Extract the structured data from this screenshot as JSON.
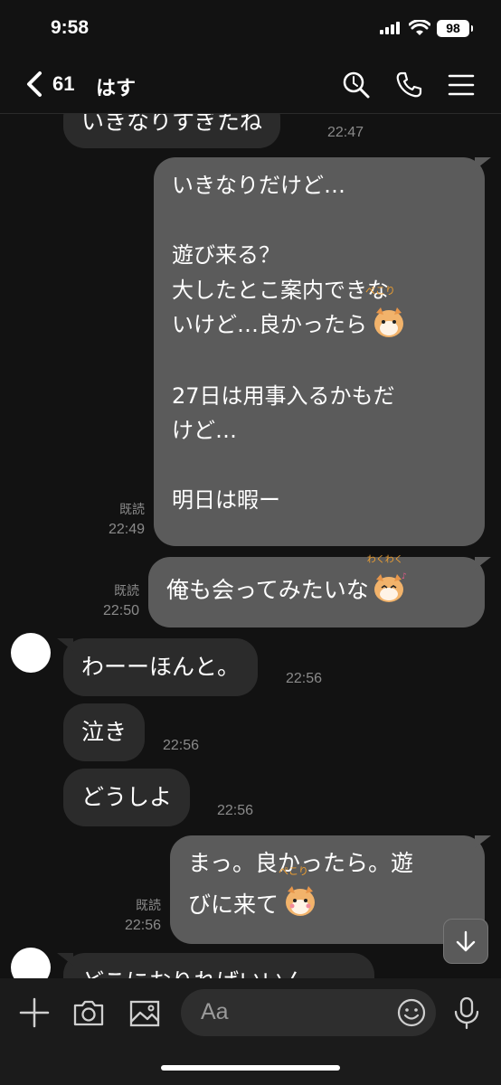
{
  "status": {
    "time": "9:58",
    "battery": "98"
  },
  "header": {
    "unread_count": "61",
    "chat_name": "はす"
  },
  "messages": {
    "m0": {
      "text": "いきなりすぎたね",
      "time": "22:47"
    },
    "m1": {
      "lines": [
        "いきなりだけど…",
        "",
        "遊び来る？",
        "大したとこ案内できな",
        "いけど…良かったら",
        "",
        "27日は用事入るかもだ",
        "けど…",
        "",
        "明日は暇ー"
      ],
      "read": "既読",
      "time": "22:49",
      "sticker_caption": "ぺこり"
    },
    "m2": {
      "text": "俺も会ってみたいな",
      "read": "既読",
      "time": "22:50",
      "sticker_caption": "わくわく"
    },
    "m3": {
      "text": "わーーほんと。",
      "time": "22:56"
    },
    "m4": {
      "text": "泣き",
      "time": "22:56"
    },
    "m5": {
      "text": "どうしよ",
      "time": "22:56"
    },
    "m6": {
      "lines": [
        "まっ。良かったら。遊",
        "びに来て"
      ],
      "read": "既読",
      "time": "22:56",
      "sticker_caption": "ぺこり"
    },
    "m7": {
      "text": "どこにおりればいいん"
    }
  },
  "input": {
    "placeholder": "Aa"
  },
  "icons": [
    "back-chevron-icon",
    "search-icon",
    "phone-icon",
    "menu-icon",
    "plus-icon",
    "camera-icon",
    "image-icon",
    "emoji-icon",
    "microphone-icon",
    "arrow-down-icon"
  ],
  "colors": {
    "background": "#121212",
    "received_bubble": "#2b2b2b",
    "sent_bubble": "#5b5b5b"
  }
}
